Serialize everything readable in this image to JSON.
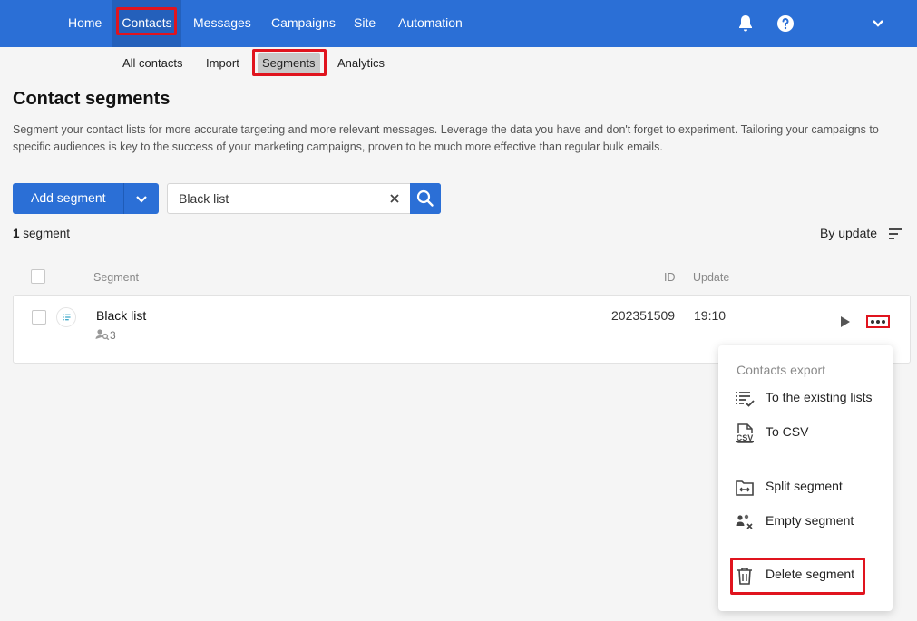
{
  "topnav": {
    "items": [
      "Home",
      "Contacts",
      "Messages",
      "Campaigns",
      "Site",
      "Automation"
    ],
    "active": "Contacts"
  },
  "subnav": {
    "items": [
      "All contacts",
      "Import",
      "Segments",
      "Analytics"
    ],
    "active": "Segments"
  },
  "page": {
    "title": "Contact segments",
    "description": "Segment your contact lists for more accurate targeting and more relevant messages. Leverage the data you have and don't forget to experiment. Tailoring your campaigns to specific audiences is key to the success of your marketing campaigns, proven to be much more effective than regular bulk emails."
  },
  "toolbar": {
    "add_label": "Add segment",
    "search_value": "Black list"
  },
  "list": {
    "count_number": "1",
    "count_label": " segment",
    "sort_label": "By update",
    "columns": {
      "segment": "Segment",
      "id": "ID",
      "update": "Update"
    },
    "rows": [
      {
        "name": "Black list",
        "contacts": "3",
        "id": "202351509",
        "update": "19:10"
      }
    ]
  },
  "menu": {
    "header": "Contacts export",
    "items": [
      {
        "label": "To the existing lists",
        "icon": "list-check-icon"
      },
      {
        "label": "To CSV",
        "icon": "csv-icon"
      },
      {
        "label": "Split segment",
        "icon": "split-folder-icon"
      },
      {
        "label": "Empty segment",
        "icon": "users-x-icon"
      },
      {
        "label": "Delete segment",
        "icon": "trash-icon"
      }
    ]
  },
  "colors": {
    "brand": "#2b6fd6",
    "highlight": "#e0141e"
  }
}
